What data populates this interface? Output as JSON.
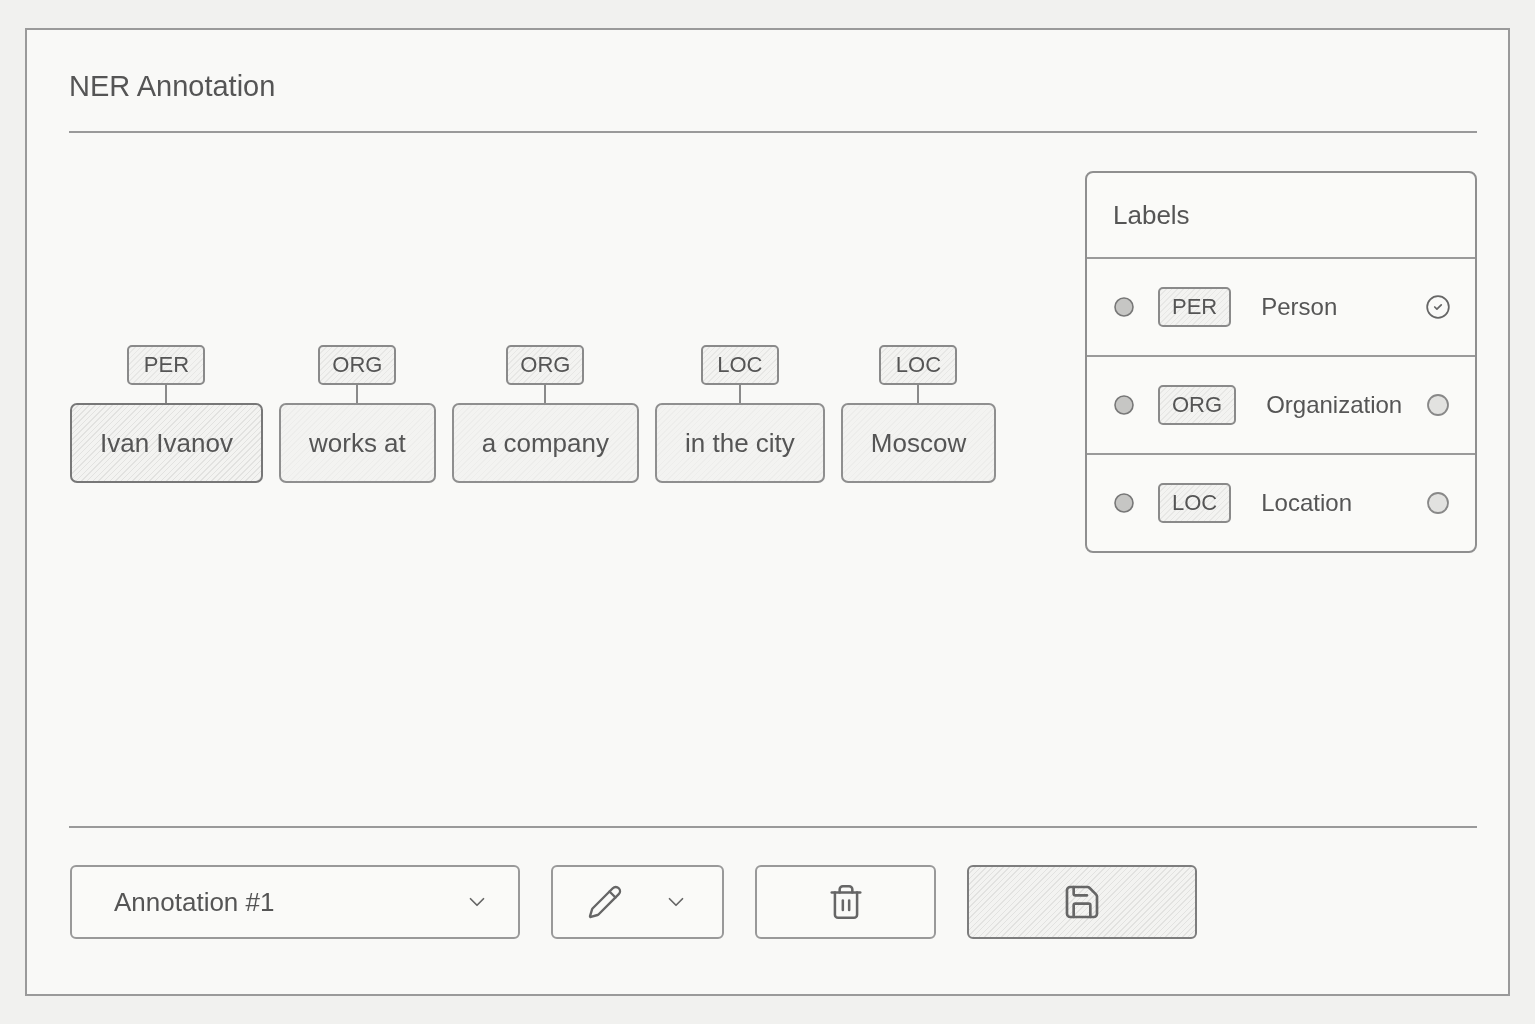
{
  "window": {
    "title": "NER Annotation"
  },
  "tokens": [
    {
      "text": "Ivan Ivanov",
      "tag": "PER",
      "selected": true
    },
    {
      "text": "works at",
      "tag": "ORG",
      "selected": false
    },
    {
      "text": "a company",
      "tag": "ORG",
      "selected": false
    },
    {
      "text": "in the city",
      "tag": "LOC",
      "selected": false
    },
    {
      "text": "Moscow",
      "tag": "LOC",
      "selected": false
    }
  ],
  "labels": {
    "title": "Labels",
    "items": [
      {
        "tag": "PER",
        "name": "Person",
        "selected": true
      },
      {
        "tag": "ORG",
        "name": "Organization",
        "selected": false
      },
      {
        "tag": "LOC",
        "name": "Location",
        "selected": false
      }
    ]
  },
  "toolbar": {
    "annotation_select": {
      "value": "Annotation #1"
    },
    "actions": [
      {
        "kind": "edit",
        "primary": false
      },
      {
        "kind": "delete",
        "primary": false
      },
      {
        "kind": "save",
        "primary": true
      }
    ]
  }
}
